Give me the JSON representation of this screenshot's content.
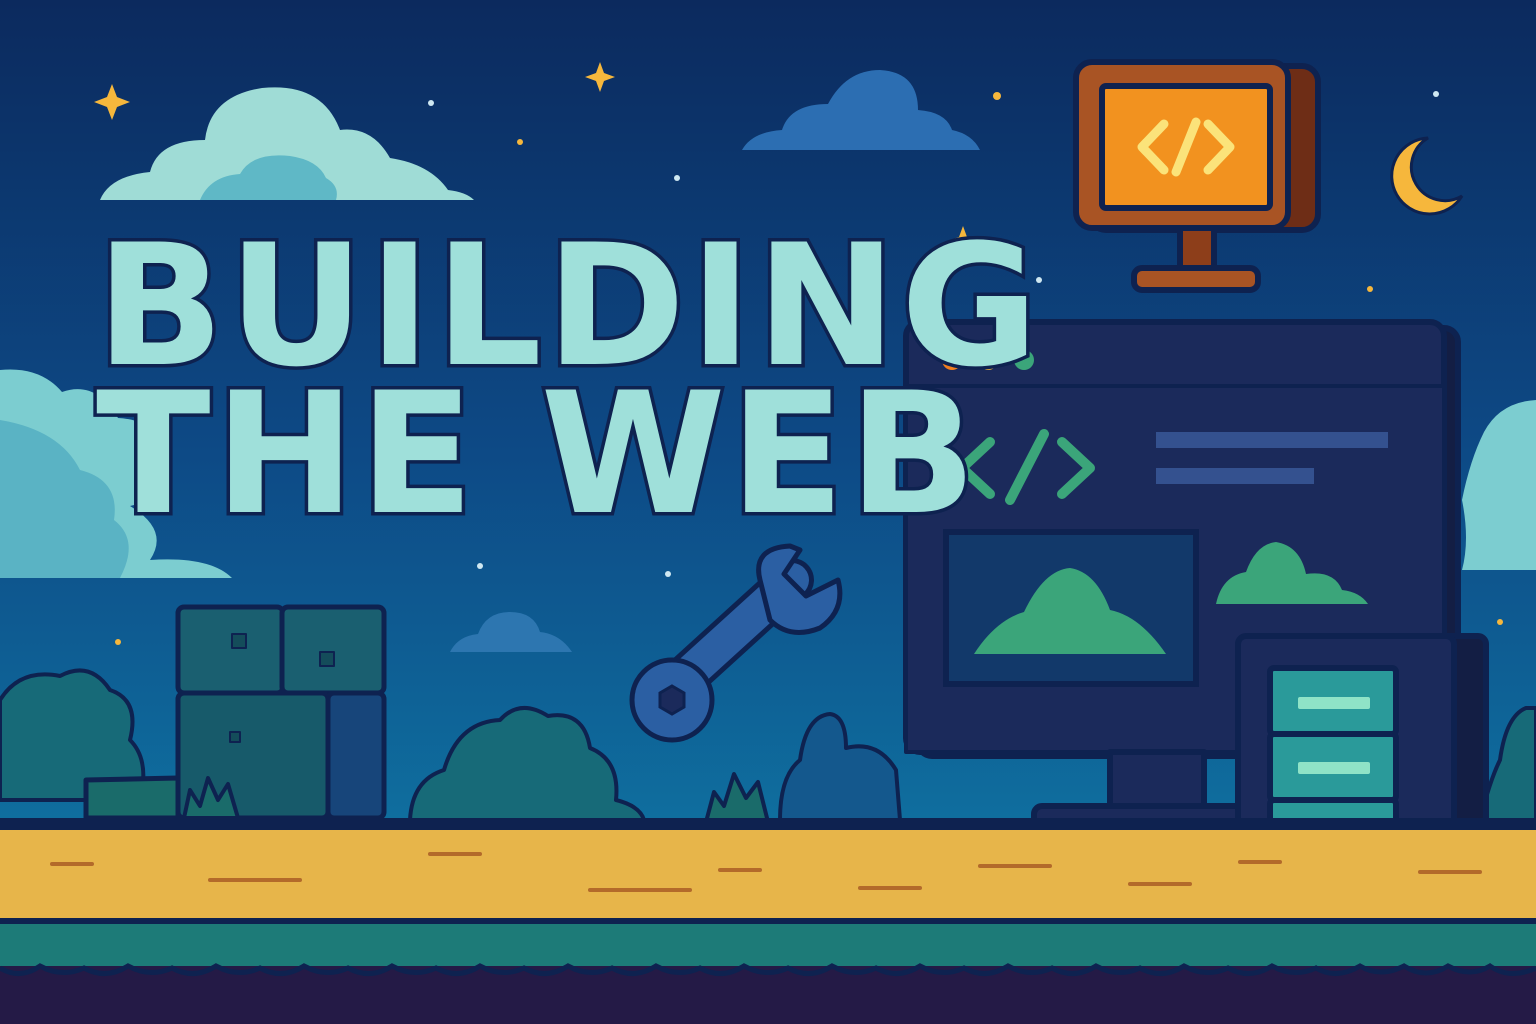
{
  "title": {
    "line1": "BUILDING",
    "line2": "THE WEB"
  },
  "icons": {
    "small_monitor": "code-icon",
    "browser_window": "code-icon",
    "tool": "wrench-icon",
    "sky": "crescent-moon-icon"
  },
  "code_glyph": "</>",
  "colors": {
    "sky_top": "#0c2a5e",
    "sky_bottom": "#0f6a9a",
    "title": "#9fe0da",
    "outline": "#0e2250",
    "road": "#e7b54a",
    "monitor_screen": "#f2921f",
    "browser_body": "#1b2a5b",
    "accent_green": "#3ba57a",
    "moon": "#f6b73c"
  }
}
